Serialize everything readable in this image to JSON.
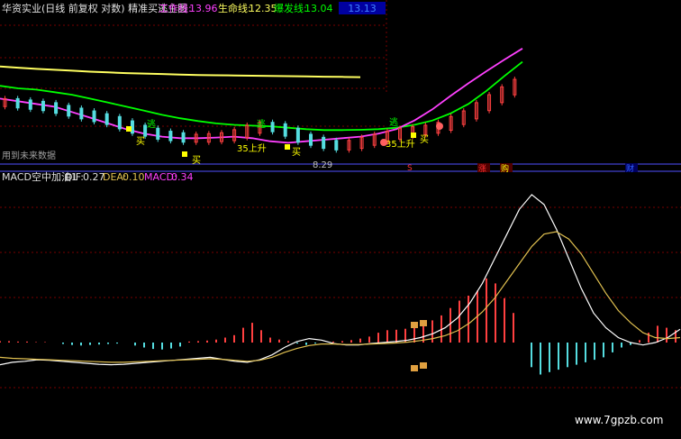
{
  "header": {
    "title": "华资实业(日线 前复权 对数) 精准买逃主图",
    "work_label": "工作线:",
    "work_value": "13.96",
    "life_label": "生命线:",
    "life_value": "12.35",
    "burst_label": "爆发线:",
    "burst_value": "13.04",
    "top_right_value": "13.13"
  },
  "main_panel": {
    "future_note": "用到未来数据",
    "signals": [
      {
        "name": "escape-1",
        "text": "逃",
        "color": "#00ff00"
      },
      {
        "name": "buy-1",
        "text": "买",
        "color": "#ffff00"
      },
      {
        "name": "buy-2",
        "text": "买",
        "color": "#ffff00"
      },
      {
        "name": "rise-1",
        "text": "35上升",
        "color": "#ffff00"
      },
      {
        "name": "escape-2",
        "text": "逃",
        "color": "#00ff00"
      },
      {
        "name": "buy-3",
        "text": "买",
        "color": "#ffff00"
      },
      {
        "name": "low-price",
        "text": "8.29",
        "color": "#c0c0c0"
      },
      {
        "name": "escape-3",
        "text": "逃",
        "color": "#00ff00"
      },
      {
        "name": "rise-2",
        "text": "35上升",
        "color": "#ffff00"
      },
      {
        "name": "buy-4",
        "text": "买",
        "color": "#ffff00"
      }
    ],
    "axis_marks": [
      {
        "name": "mark-s",
        "text": "S",
        "color": "#ff3030"
      },
      {
        "name": "mark-zhang",
        "text": "涨",
        "color": "#ff3030"
      },
      {
        "name": "mark-gou",
        "text": "购",
        "color": "#ffff00"
      },
      {
        "name": "mark-cai",
        "text": "财",
        "color": "#3060ff"
      }
    ]
  },
  "indicator_panel": {
    "title": "MACD空中加油1",
    "dif_label": "DIF:",
    "dif_value": "0.27",
    "dea_label": "DEA:",
    "dea_value": "0.10",
    "macd_label": "MACD:",
    "macd_value": "0.34"
  },
  "watermark": "www.7gpzb.com",
  "colors": {
    "background": "#000000",
    "grid": "#8b0000",
    "divider": "#5050ff",
    "up": "#ff4040",
    "down": "#55dde0",
    "dif": "#ffffff",
    "dea": "#e0c050",
    "macd_label": "#ff40ff",
    "work_line": "#ff40ff",
    "life_line": "#00ff00",
    "burst_line": "#ffff60"
  },
  "chart_data": [
    {
      "type": "line",
      "title": "华资实业(日线 前复权 对数) 精准买逃主图",
      "x": [
        0,
        20,
        40,
        60,
        80,
        100,
        120,
        140,
        160,
        180,
        200,
        220,
        240,
        260,
        280,
        300,
        320,
        340,
        360,
        380,
        400,
        420,
        440,
        460,
        480,
        500,
        520,
        540,
        560,
        580
      ],
      "series": [
        {
          "name": "工作线",
          "color": "#ff40ff",
          "values": [
            10.1,
            10.0,
            9.9,
            9.8,
            9.6,
            9.4,
            9.2,
            9.0,
            8.85,
            8.75,
            8.7,
            8.7,
            8.72,
            8.75,
            8.7,
            8.6,
            8.55,
            8.6,
            8.65,
            8.7,
            8.75,
            8.85,
            9.0,
            9.3,
            9.7,
            10.2,
            10.7,
            11.2,
            11.7,
            12.2
          ]
        },
        {
          "name": "生命线",
          "color": "#00ff00",
          "values": [
            10.6,
            10.5,
            10.45,
            10.35,
            10.25,
            10.1,
            9.95,
            9.8,
            9.65,
            9.5,
            9.38,
            9.28,
            9.2,
            9.15,
            9.12,
            9.1,
            9.05,
            9.0,
            8.97,
            8.97,
            8.98,
            9.0,
            9.05,
            9.15,
            9.3,
            9.55,
            9.9,
            10.4,
            11.0,
            11.6
          ]
        },
        {
          "name": "爆发线",
          "color": "#ffff60",
          "values": [
            11.4,
            11.35,
            11.3,
            11.26,
            11.22,
            11.18,
            11.15,
            11.12,
            11.1,
            11.08,
            11.06,
            11.04,
            11.03,
            11.02,
            11.01,
            11.0,
            10.99,
            10.98,
            10.97,
            10.96,
            10.95
          ]
        }
      ],
      "candles_close": [
        9.95,
        9.9,
        9.85,
        9.8,
        9.7,
        9.6,
        9.5,
        9.4,
        9.3,
        9.15,
        9.0,
        8.9,
        8.8,
        8.75,
        8.7,
        8.7,
        8.72,
        8.75,
        8.85,
        9.0,
        9.1,
        9.05,
        8.9,
        8.7,
        8.6,
        8.5,
        8.45,
        8.5,
        8.6,
        8.7,
        8.8,
        8.9,
        8.95,
        9.0,
        9.1,
        9.3,
        9.5,
        9.8,
        10.1,
        10.4,
        10.7
      ],
      "ylim": [
        8.0,
        13.5
      ],
      "log_scale": true,
      "grid": true
    },
    {
      "type": "bar",
      "title": "MACD空中加油1",
      "x": [
        0,
        10,
        20,
        30,
        40,
        50,
        60,
        70,
        80,
        90,
        100,
        110,
        120,
        130,
        140,
        150,
        160,
        170,
        180,
        190,
        200,
        210,
        220,
        230,
        240,
        250,
        260,
        270,
        280,
        290,
        300,
        310,
        320,
        330,
        340,
        350,
        360,
        370,
        380,
        390,
        400,
        410,
        420,
        430,
        440,
        450,
        460,
        470,
        480,
        490,
        500,
        510,
        520,
        530,
        540,
        550,
        560,
        570,
        580,
        590,
        600,
        610,
        620,
        630,
        640,
        650,
        660,
        670,
        680,
        690,
        700,
        710,
        720,
        730,
        740,
        750
      ],
      "series": [
        {
          "name": "MACD",
          "values": [
            0.03,
            0.03,
            0.02,
            0.02,
            0.01,
            0.01,
            0.0,
            -0.03,
            -0.05,
            -0.06,
            -0.05,
            -0.04,
            -0.03,
            -0.02,
            0.0,
            -0.06,
            -0.1,
            -0.13,
            -0.14,
            -0.12,
            -0.08,
            0.02,
            0.03,
            0.04,
            0.06,
            0.1,
            0.15,
            0.3,
            0.4,
            0.25,
            0.1,
            0.06,
            0.03,
            -0.02,
            -0.05,
            -0.02,
            0.0,
            0.02,
            0.03,
            0.05,
            0.08,
            0.12,
            0.2,
            0.25,
            0.26,
            0.28,
            0.3,
            0.35,
            0.45,
            0.55,
            0.7,
            0.85,
            0.95,
            1.05,
            1.3,
            1.2,
            0.9,
            0.6,
            0.0,
            -0.5,
            -0.65,
            -0.6,
            -0.55,
            -0.5,
            -0.45,
            -0.4,
            -0.35,
            -0.3,
            -0.2,
            -0.1,
            -0.05,
            0.05,
            0.2,
            0.34,
            0.3,
            0.25
          ]
        },
        {
          "name": "DIF",
          "color": "#ffffff",
          "values": [
            -0.45,
            -0.4,
            -0.38,
            -0.35,
            -0.36,
            -0.38,
            -0.4,
            -0.42,
            -0.44,
            -0.45,
            -0.44,
            -0.42,
            -0.4,
            -0.38,
            -0.36,
            -0.34,
            -0.32,
            -0.3,
            -0.34,
            -0.38,
            -0.4,
            -0.35,
            -0.25,
            -0.1,
            0.02,
            0.08,
            0.05,
            -0.02,
            -0.05,
            -0.05,
            -0.02,
            0.0,
            0.02,
            0.05,
            0.1,
            0.18,
            0.3,
            0.5,
            0.8,
            1.2,
            1.7,
            2.2,
            2.7,
            3.0,
            2.8,
            2.3,
            1.7,
            1.1,
            0.6,
            0.3,
            0.1,
            0.0,
            -0.05,
            0.0,
            0.1,
            0.27
          ]
        },
        {
          "name": "DEA",
          "color": "#e0c050",
          "values": [
            -0.3,
            -0.32,
            -0.33,
            -0.34,
            -0.35,
            -0.36,
            -0.37,
            -0.38,
            -0.39,
            -0.4,
            -0.4,
            -0.39,
            -0.38,
            -0.37,
            -0.36,
            -0.35,
            -0.34,
            -0.33,
            -0.34,
            -0.36,
            -0.38,
            -0.36,
            -0.3,
            -0.2,
            -0.12,
            -0.06,
            -0.03,
            -0.03,
            -0.04,
            -0.04,
            -0.03,
            -0.02,
            -0.01,
            0.01,
            0.04,
            0.08,
            0.14,
            0.24,
            0.4,
            0.62,
            0.9,
            1.25,
            1.6,
            1.95,
            2.2,
            2.25,
            2.1,
            1.8,
            1.4,
            1.0,
            0.65,
            0.4,
            0.2,
            0.1,
            0.08,
            0.1
          ]
        }
      ],
      "ylim": [
        -0.7,
        3.2
      ],
      "grid": true
    }
  ]
}
